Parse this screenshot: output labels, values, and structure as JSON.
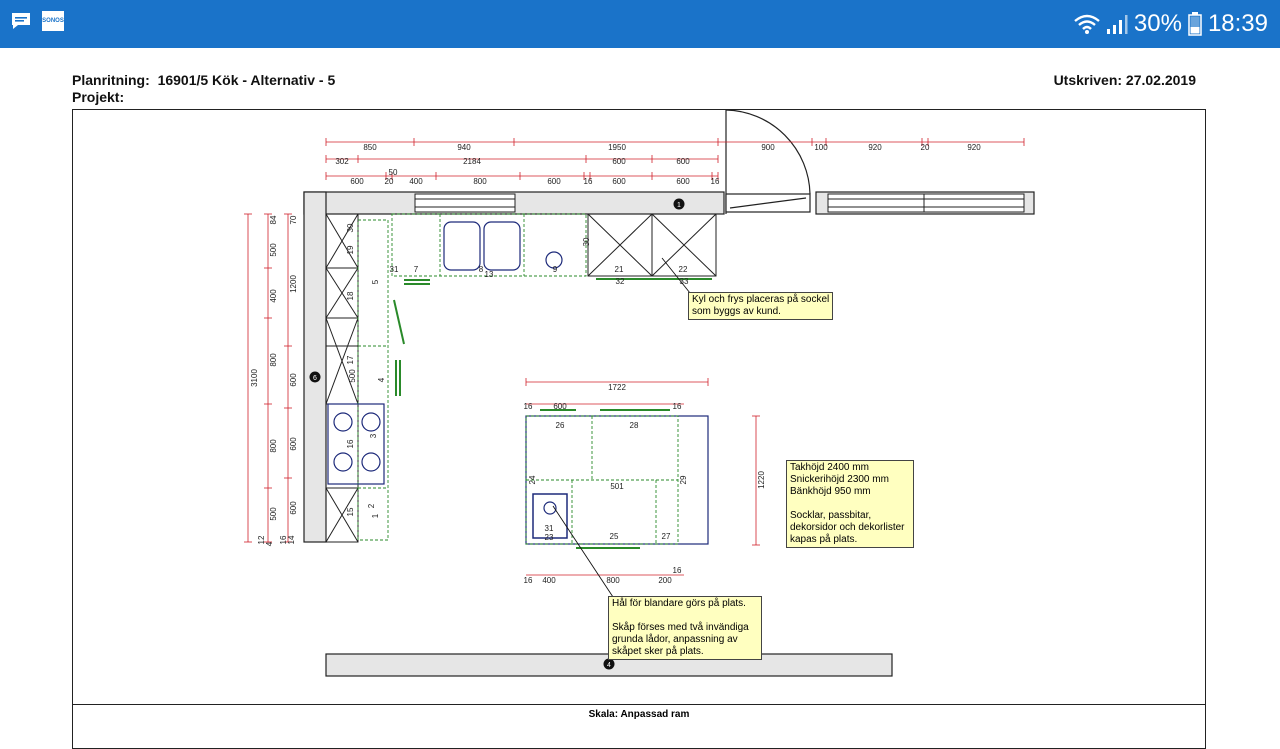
{
  "status_bar": {
    "battery_percent": "30%",
    "time": "18:39",
    "sonos_label": "SONOS"
  },
  "header": {
    "plan_label": "Planritning:",
    "plan_value": "16901/5  Kök - Alternativ - 5",
    "project_label": "Projekt:",
    "printed_label": "Utskriven: 27.02.2019"
  },
  "footer": {
    "scale_label": "Skala: Anpassad ram"
  },
  "notes": {
    "fridge": "Kyl och frys placeras på sockel\nsom byggs av kund.",
    "heights": "Takhöjd 2400 mm\nSnickerihöjd 2300 mm\nBänkhöjd 950 mm\n\nSocklar, passbitar,\ndekorsidor och dekorlister\nkapas på plats.",
    "mixer": "Hål för blandare görs på plats.\n\nSkåp förses med två invändiga\ngrunda lådor, anpassning av\nskåpet sker på plats."
  },
  "dims": {
    "top_row1": [
      "850",
      "940",
      "1950",
      "900",
      "100",
      "920",
      "20",
      "920"
    ],
    "top_row2": [
      "302",
      "2184",
      "600",
      "600"
    ],
    "top_row2b": [
      "50"
    ],
    "top_row3": [
      "600",
      "20",
      "400",
      "800",
      "600",
      "16",
      "600",
      "600",
      "16"
    ],
    "left_outer": "3100",
    "left_col1": [
      "84",
      "500",
      "400",
      "800",
      "800",
      "500",
      "12",
      "4"
    ],
    "left_col2": [
      "70",
      "1200",
      "600",
      "600",
      "600",
      "16",
      "14"
    ],
    "island_top": "1722",
    "island_top_row": [
      "16",
      "600",
      "16"
    ],
    "island_side": "1220",
    "island_bottom": [
      "16",
      "400",
      "800",
      "200",
      "16"
    ]
  },
  "labels": {
    "wall_cabinets": [
      "30",
      "19",
      "18",
      "17",
      "16",
      "15"
    ],
    "base": [
      "5",
      "4",
      "500",
      "3",
      "2",
      "1"
    ],
    "top_units": [
      "31",
      "7",
      "8",
      "13",
      "9",
      "30",
      "21",
      "22",
      "32",
      "33"
    ],
    "island": [
      "26",
      "28",
      "24",
      "501",
      "29",
      "31",
      "23",
      "25",
      "27"
    ],
    "markers": [
      "1",
      "6",
      "4"
    ]
  },
  "colors": {
    "accent": "#1a73c9",
    "dim_line": "#d0202a",
    "green": "#2a8a2a",
    "navy": "#1d2a7a"
  }
}
